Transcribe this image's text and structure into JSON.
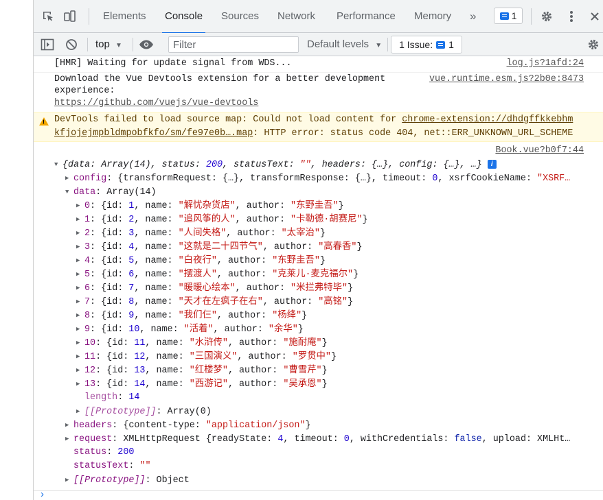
{
  "tabs": [
    "Elements",
    "Console",
    "Sources",
    "Network",
    "Performance",
    "Memory"
  ],
  "more_tabs": "»",
  "issue_badge_count": "1",
  "toolbar": {
    "context": "top",
    "filter_placeholder": "Filter",
    "levels": "Default levels",
    "issues_label": "1 Issue:",
    "issues_count": "1"
  },
  "messages": {
    "hmr": {
      "text": "[HMR] Waiting for update signal from WDS...",
      "source": "log.js?1afd:24"
    },
    "vue": {
      "text1": "Download the Vue Devtools extension for a better development",
      "text2": "experience:",
      "link": "https://github.com/vuejs/vue-devtools",
      "source": "vue.runtime.esm.js?2b0e:8473"
    },
    "warning": {
      "text1": "DevTools failed to load source map: Could not load content for ",
      "link1": "chrome-extension://dhdgffkkebhm",
      "link2": "kfjojejmpbldmpobfkfo/sm/fe97e0b….map",
      "text2": ": HTTP error: status code 404, net::ERR_UNKNOWN_URL_SCHEME"
    },
    "book_source": "Book.vue?b0f7:44"
  },
  "obj": {
    "summary": {
      "p1": "{data: Array(14), status: ",
      "status": "200",
      "p2": ", statusText: ",
      "statusText": "\"\"",
      "p3": ", headers: {…}, config: {…}, …}"
    },
    "config": {
      "key": "config",
      "v1": ": {transformRequest: {…}, transformResponse: {…}, timeout: ",
      "timeout": "0",
      "v2": ", xsrfCookieName: ",
      "xsrf": "\"XSRF…"
    },
    "data_key": "data",
    "data_val": ": Array(14)",
    "rows": [
      {
        "i": "0",
        "id": "1",
        "name": "\"解忧杂货店\"",
        "author": "\"东野圭吾\""
      },
      {
        "i": "1",
        "id": "2",
        "name": "\"追风筝的人\"",
        "author": "\"卡勒德·胡赛尼\""
      },
      {
        "i": "2",
        "id": "3",
        "name": "\"人间失格\"",
        "author": "\"太宰治\""
      },
      {
        "i": "3",
        "id": "4",
        "name": "\"这就是二十四节气\"",
        "author": "\"高春香\""
      },
      {
        "i": "4",
        "id": "5",
        "name": "\"白夜行\"",
        "author": "\"东野圭吾\""
      },
      {
        "i": "5",
        "id": "6",
        "name": "\"摆渡人\"",
        "author": "\"克莱儿·麦克福尔\""
      },
      {
        "i": "6",
        "id": "7",
        "name": "\"暖暖心绘本\"",
        "author": "\"米拦弗特毕\""
      },
      {
        "i": "7",
        "id": "8",
        "name": "\"天才在左疯子在右\"",
        "author": "\"高铭\""
      },
      {
        "i": "8",
        "id": "9",
        "name": "\"我们仨\"",
        "author": "\"杨绛\""
      },
      {
        "i": "9",
        "id": "10",
        "name": "\"活着\"",
        "author": "\"余华\""
      },
      {
        "i": "10",
        "id": "11",
        "name": "\"水浒传\"",
        "author": "\"施耐庵\""
      },
      {
        "i": "11",
        "id": "12",
        "name": "\"三国演义\"",
        "author": "\"罗贯中\""
      },
      {
        "i": "12",
        "id": "13",
        "name": "\"红楼梦\"",
        "author": "\"曹雪芹\""
      },
      {
        "i": "13",
        "id": "14",
        "name": "\"西游记\"",
        "author": "\"吴承恩\""
      }
    ],
    "length_key": "length",
    "length_val": "14",
    "proto_key": "[[Prototype]]",
    "proto_array": ": Array(0)",
    "headers": {
      "key": "headers",
      "v1": ": {content-type: ",
      "ct": "\"application/json\"",
      "v2": "}"
    },
    "request": {
      "key": "request",
      "v1": ": XMLHttpRequest {readyState: ",
      "rs": "4",
      "v2": ", timeout: ",
      "to": "0",
      "v3": ", withCredentials: ",
      "wc": "false",
      "v4": ", upload: XMLHt…"
    },
    "status_key": "status",
    "status_val": "200",
    "statusText_key": "statusText",
    "statusText_val": "\"\"",
    "proto_object": ": Object"
  },
  "prompt": "›"
}
